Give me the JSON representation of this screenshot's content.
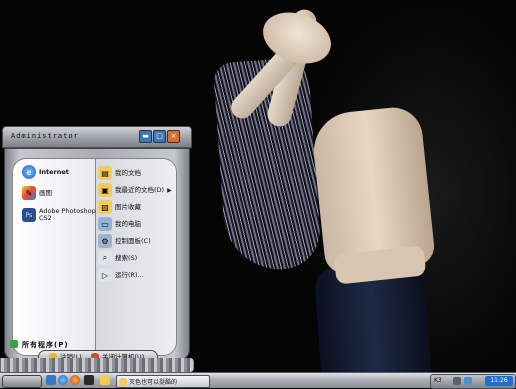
{
  "start_menu": {
    "user": "Administrator",
    "pinned": [
      {
        "label": "Internet",
        "icon": "internet-explorer-icon"
      },
      {
        "label": "画图",
        "icon": "paint-icon"
      },
      {
        "label": "Adobe Photoshop",
        "label2": "CS2",
        "icon": "photoshop-icon"
      }
    ],
    "places": [
      {
        "label": "我的文档",
        "icon": "folder-icon"
      },
      {
        "label": "我最近的文档(D)",
        "icon": "recent-docs-icon",
        "submenu": true
      },
      {
        "label": "图片收藏",
        "icon": "pictures-icon"
      },
      {
        "label": "我的电脑",
        "icon": "computer-icon"
      },
      {
        "label": "控制面板(C)",
        "icon": "control-panel-icon"
      },
      {
        "label": "搜索(S)",
        "icon": "search-icon"
      },
      {
        "label": "运行(R)...",
        "icon": "run-icon"
      }
    ],
    "all_programs": "所有程序(P)",
    "logoff": "注销(L)",
    "shutdown": "关闭计算机(U)"
  },
  "taskbar": {
    "task": "灭色也可以挺酷的",
    "tray_lang": "K3",
    "clock": "11:26"
  },
  "colors": {
    "accent": "#1f6fd0",
    "chrome": "#a9adb3"
  }
}
